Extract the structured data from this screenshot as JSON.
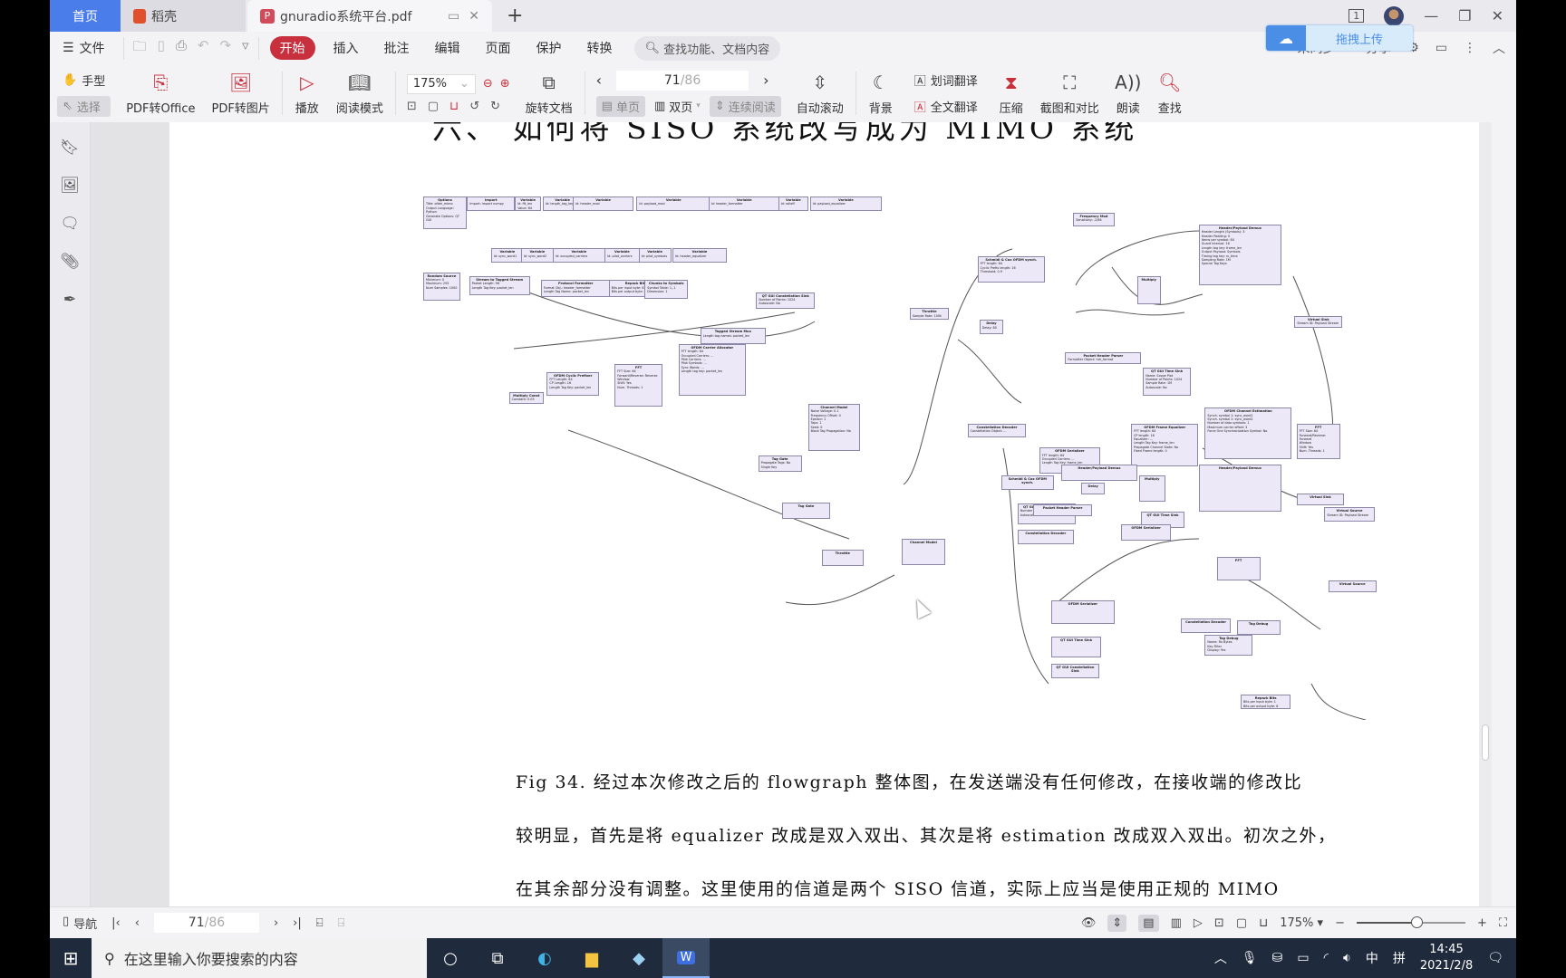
{
  "tabs": {
    "home": "首页",
    "daoke": "稻壳",
    "document": "gnuradio系统平台.pdf",
    "add_icon": "plus-icon"
  },
  "window": {
    "page_counter": "1",
    "controls": [
      "minimize-icon",
      "restore-icon",
      "close-icon"
    ]
  },
  "menubar": {
    "file": "文件",
    "items": [
      "开始",
      "插入",
      "批注",
      "编辑",
      "页面",
      "保护",
      "转换"
    ],
    "active": "开始",
    "search_placeholder": "查找功能、文档内容",
    "right_items": [
      "未同步",
      "分享"
    ],
    "upload_label": "拖拽上传"
  },
  "ribbon": {
    "hand": "手型",
    "select": "选择",
    "pdf_to_office": "PDF转Office",
    "pdf_to_image": "PDF转图片",
    "play": "播放",
    "read_mode": "阅读模式",
    "zoom_level": "175%",
    "rotate": "旋转文档",
    "page_current": "71",
    "page_total": "/86",
    "single": "单页",
    "double": "双页",
    "continuous": "连续阅读",
    "auto_scroll": "自动滚动",
    "background": "背景",
    "word_translate": "划词翻译",
    "full_translate": "全文翻译",
    "compress": "压缩",
    "screenshot_compare": "截图和对比",
    "read_aloud": "朗读",
    "find": "查找"
  },
  "document": {
    "heading": "六、 如何将 SISO 系统改写成为 MIMO 系统",
    "caption_lines": [
      "Fig 34.  经过本次修改之后的 flowgraph 整体图，在发送端没有任何修改，在接收端的修改比",
      "较明显，首先是将 equalizer 改成是双入双出、其次是将 estimation 改成双入双出。初次之外，",
      "在其余部分没有调整。这里使用的信道是两个 SISO 信道，实际上应当是使用正规的 MIMO"
    ],
    "flowgraph_blocks": [
      {
        "title": "Options",
        "lines": [
          "Title: ofdm_mimo",
          "Output Language: Python",
          "Generate Options: QT GUI"
        ]
      },
      {
        "title": "Import",
        "lines": [
          "Import: import numpy"
        ]
      },
      {
        "title": "Variable",
        "lines": [
          "Id: fft_len",
          "Value: 64"
        ]
      },
      {
        "title": "Variable",
        "lines": [
          "Id: length_tag_key"
        ]
      },
      {
        "title": "Variable",
        "lines": [
          "Id: header_mod"
        ]
      },
      {
        "title": "Variable",
        "lines": [
          "Id: payload_mod"
        ]
      },
      {
        "title": "Variable",
        "lines": [
          "Id: header_formatter"
        ]
      },
      {
        "title": "Variable",
        "lines": [
          "Id: rolloff"
        ]
      },
      {
        "title": "Variable",
        "lines": [
          "Id: payload_equalizer"
        ]
      },
      {
        "title": "Variable",
        "lines": [
          "Id: sync_word1"
        ]
      },
      {
        "title": "Variable",
        "lines": [
          "Id: sync_word2"
        ]
      },
      {
        "title": "Variable",
        "lines": [
          "Id: occupied_carriers"
        ]
      },
      {
        "title": "Variable",
        "lines": [
          "Id: pilot_carriers"
        ]
      },
      {
        "title": "Variable",
        "lines": [
          "Id: pilot_symbols"
        ]
      },
      {
        "title": "Variable",
        "lines": [
          "Id: header_equalizer"
        ]
      },
      {
        "title": "Random Source",
        "lines": [
          "Minimum: 0",
          "Maximum: 255",
          "Num Samples: 1000"
        ]
      },
      {
        "title": "Stream to Tagged Stream",
        "lines": [
          "Packet Length: 96",
          "Length Tag Key: packet_len"
        ]
      },
      {
        "title": "Protocol Formatter",
        "lines": [
          "Format Obj.: header_formatter",
          "Length Tag Name: packet_len"
        ]
      },
      {
        "title": "Repack Bits",
        "lines": [
          "Bits per input byte: 8",
          "Bits per output byte: 1"
        ]
      },
      {
        "title": "Chunks to Symbols",
        "lines": [
          "Symbol Table: 1,-1",
          "Dimension: 1"
        ]
      },
      {
        "title": "Tagged Stream Mux",
        "lines": [
          "Length tag names: packet_len"
        ]
      },
      {
        "title": "QT GUI Constellation Sink",
        "lines": [
          "Number of Points: 1024",
          "Autoscale: No"
        ]
      },
      {
        "title": "OFDM Carrier Allocator",
        "lines": [
          "FFT length: 64",
          "Occupied Carriers: ...",
          "Pilot Carriers: ...",
          "Pilot Symbols: ...",
          "Sync Words: ...",
          "Length tag key: packet_len"
        ]
      },
      {
        "title": "FFT",
        "lines": [
          "FFT Size: 64",
          "Forward/Reverse: Reverse",
          "Window",
          "Shift: Yes",
          "Num. Threads: 1"
        ]
      },
      {
        "title": "OFDM Cyclic Prefixer",
        "lines": [
          "FFT Length: 64",
          "CP Length: 16",
          "Length Tag Key: packet_len"
        ]
      },
      {
        "title": "Multiply Const",
        "lines": [
          "Constant: 0.05"
        ]
      },
      {
        "title": "Tag Gate",
        "lines": [
          "Propagate Tags: No",
          "Single Key"
        ]
      },
      {
        "title": "Channel Model",
        "lines": [
          "Noise Voltage: 0.1",
          "Frequency Offset: 0",
          "Epsilon: 1",
          "Taps: 1",
          "Seed: 0",
          "Block Tag Propagation: No"
        ]
      },
      {
        "title": "Throttle",
        "lines": [
          "Sample Rate: 100k"
        ]
      },
      {
        "title": "Schmidl & Cox OFDM synch.",
        "lines": [
          "FFT length: 64",
          "Cyclic Prefix length: 16",
          "Threshold: 0.9"
        ]
      },
      {
        "title": "Frequency Mod",
        "lines": [
          "Sensitivity: -2/64"
        ]
      },
      {
        "title": "Delay",
        "lines": [
          "Delay: 80"
        ]
      },
      {
        "title": "Multiply",
        "lines": []
      },
      {
        "title": "Header/Payload Demux",
        "lines": [
          "Header Length (Symbols): 3",
          "Header Padding: 0",
          "Items per symbol: 80",
          "Guard Interval: 16",
          "Length tag key: frame_len",
          "Output Payload: Symbols",
          "Timing tag key: rx_time",
          "Sampling Rate: 1M",
          "Special Tag Keys"
        ]
      },
      {
        "title": "Virtual Sink",
        "lines": [
          "Stream ID: Payload Stream"
        ]
      },
      {
        "title": "Packet Header Parser",
        "lines": [
          "Formatter Object: hdr_format"
        ]
      },
      {
        "title": "QT GUI Time Sink",
        "lines": [
          "Name: Scope Plot",
          "Number of Points: 1024",
          "Sample Rate: 1M",
          "Autoscale: No"
        ]
      },
      {
        "title": "Constellation Decoder",
        "lines": [
          "Constellation Object: ..."
        ]
      },
      {
        "title": "OFDM Serializer",
        "lines": [
          "FFT length: 64",
          "Occupied Carriers: ...",
          "Length Tag Key: frame_len"
        ]
      },
      {
        "title": "OFDM Frame Equalizer",
        "lines": [
          "FFT length: 64",
          "CP length: 16",
          "Equalizer: ...",
          "Length Tag Key: frame_len",
          "Propagate Channel State: No",
          "Fixed Frame length: 0"
        ]
      },
      {
        "title": "OFDM Channel Estimation",
        "lines": [
          "Synch. symbol 1: sync_word1",
          "Synch. symbol 2: sync_word2",
          "Number of data symbols: 1",
          "Maximum carrier offset: 3",
          "Force One Synchronization Symbol: No"
        ]
      },
      {
        "title": "FFT",
        "lines": [
          "FFT Size: 64",
          "Forward/Reverse: Forward",
          "Window",
          "Shift: Yes",
          "Num. Threads: 1"
        ]
      },
      {
        "title": "QT GUI Constellation Sink",
        "lines": [
          "Number of Points: 1024",
          "Autoscale: No"
        ]
      },
      {
        "title": "Virtual Source",
        "lines": [
          "Stream ID: Payload Stream"
        ]
      },
      {
        "title": "Repack Bits",
        "lines": [
          "Bits per input byte: 1",
          "Bits per output byte: 8"
        ]
      },
      {
        "title": "Tag Debug",
        "lines": [
          "Name: Rx Bytes",
          "Key Filter",
          "Display: Yes"
        ]
      }
    ]
  },
  "statusbar": {
    "nav": "导航",
    "page_current": "71",
    "page_total": "/86",
    "zoom": "175%",
    "zoom_fraction": 0.55
  },
  "taskbar": {
    "search_placeholder": "在这里输入你要搜索的内容",
    "ime_lang": "中",
    "ime_mode": "拼",
    "time": "14:45",
    "date": "2021/2/8"
  }
}
